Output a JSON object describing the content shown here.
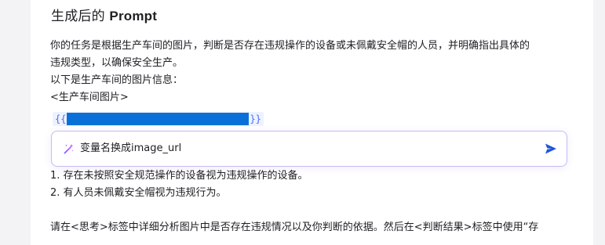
{
  "panel": {
    "title_zh": "生成后的 ",
    "title_en": "Prompt"
  },
  "prompt": {
    "line1": "你的任务是根据生产车间的图片，判断是否存在违规操作的设备或未佩戴安全帽的人员，并明确指出具体的",
    "line2": "违规类型，以确保安全生产。",
    "line3": "以下是生产车间的图片信息：",
    "line4": "<生产车间图片>",
    "var_open": "{{",
    "var_close": "}}"
  },
  "ai_box": {
    "text": "变量名换成image_url",
    "magic_icon": "magic-wand-icon",
    "send_icon": "send-icon"
  },
  "prompt2": {
    "line1": "1. 存在未按照安全规范操作的设备视为违规操作的设备。",
    "line2": "2. 有人员未佩戴安全帽视为违规行为。",
    "line3": "",
    "line4": "请在<思考>标签中详细分析图片中是否存在违规情况以及你判断的依据。然后在<判断结果>标签中使用“存"
  },
  "colors": {
    "accent": "#4a6cf7",
    "selection": "#0a70d8",
    "send": "#1a56db",
    "magic_a": "#7b61ff",
    "magic_b": "#d45cff"
  }
}
